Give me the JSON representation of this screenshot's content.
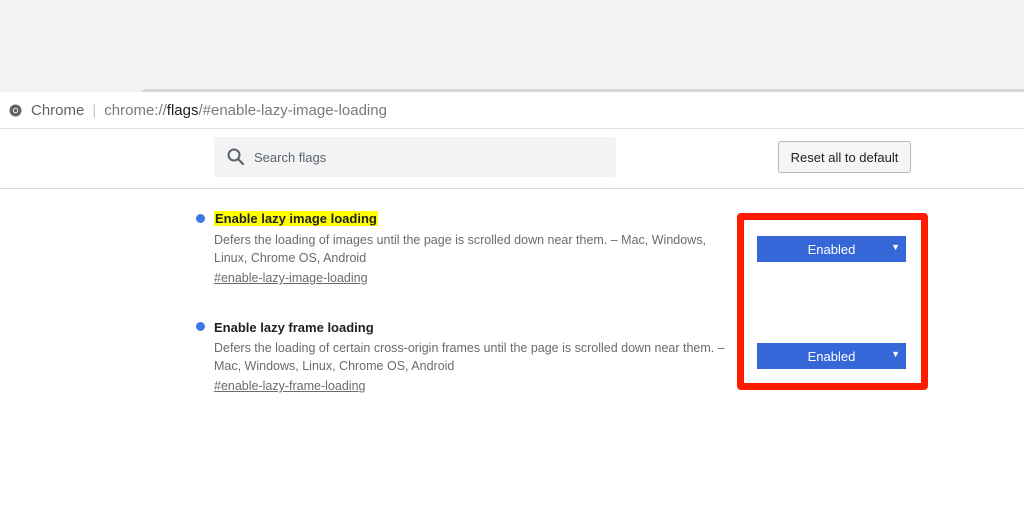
{
  "omnibox": {
    "site_label": "Chrome",
    "separator": "|",
    "url_scheme": "chrome://",
    "url_host": "flags",
    "url_rest": "/#enable-lazy-image-loading",
    "icon": "chrome-icon"
  },
  "header": {
    "search_placeholder": "Search flags",
    "search_value": "",
    "search_icon": "search-icon",
    "reset_label": "Reset all to default"
  },
  "experiments": [
    {
      "title": "Enable lazy image loading",
      "highlighted": true,
      "description": "Defers the loading of images until the page is scrolled down near them. – Mac, Windows, Linux, Chrome OS, Android",
      "link": "#enable-lazy-image-loading",
      "selected_option": "Enabled"
    },
    {
      "title": "Enable lazy frame loading",
      "highlighted": false,
      "description": "Defers the loading of certain cross-origin frames until the page is scrolled down near them. – Mac, Windows, Linux, Chrome OS, Android",
      "link": "#enable-lazy-frame-loading",
      "selected_option": "Enabled"
    }
  ],
  "colors": {
    "accent_blue": "#3567d9",
    "dot_blue": "#3b78e7",
    "highlight_yellow": "#ffff00",
    "annotation_red": "#ff1a00"
  }
}
